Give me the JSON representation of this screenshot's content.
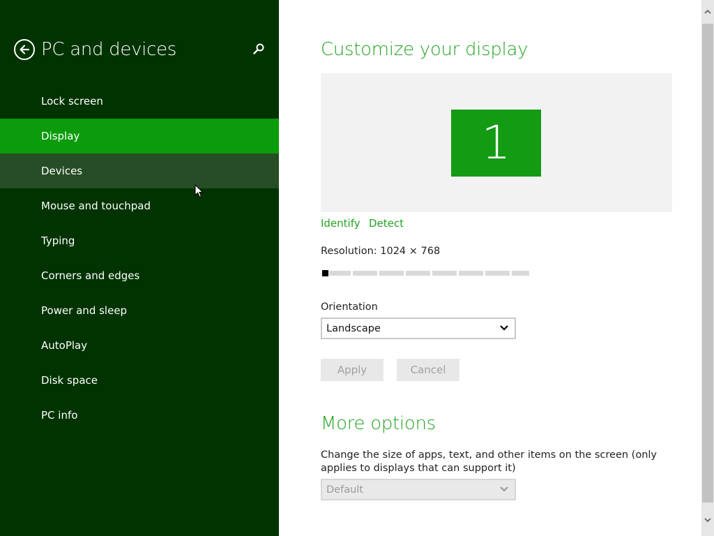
{
  "sidebar": {
    "title": "PC and devices",
    "items": [
      {
        "label": "Lock screen"
      },
      {
        "label": "Display"
      },
      {
        "label": "Devices"
      },
      {
        "label": "Mouse and touchpad"
      },
      {
        "label": "Typing"
      },
      {
        "label": "Corners and edges"
      },
      {
        "label": "Power and sleep"
      },
      {
        "label": "AutoPlay"
      },
      {
        "label": "Disk space"
      },
      {
        "label": "PC info"
      }
    ],
    "selected_index": 1,
    "hovered_index": 2,
    "icons": {
      "back": "back-arrow-icon",
      "search": "search-icon"
    }
  },
  "main": {
    "title": "Customize your display",
    "monitor_number": "1",
    "identify_label": "Identify",
    "detect_label": "Detect",
    "resolution_label": "Resolution: 1024 × 768",
    "resolution_slider_position": 0,
    "orientation_label": "Orientation",
    "orientation_value": "Landscape",
    "apply_label": "Apply",
    "cancel_label": "Cancel",
    "more_options_title": "More options",
    "size_description": "Change the size of apps, text, and other items on the screen (only applies to displays that can support it)",
    "size_value": "Default"
  },
  "colors": {
    "sidebar_bg": "#003300",
    "selected_bg": "#0c9b0c",
    "hover_bg": "#264d26",
    "accent": "#22a322",
    "monitor_tile": "#149b14"
  }
}
